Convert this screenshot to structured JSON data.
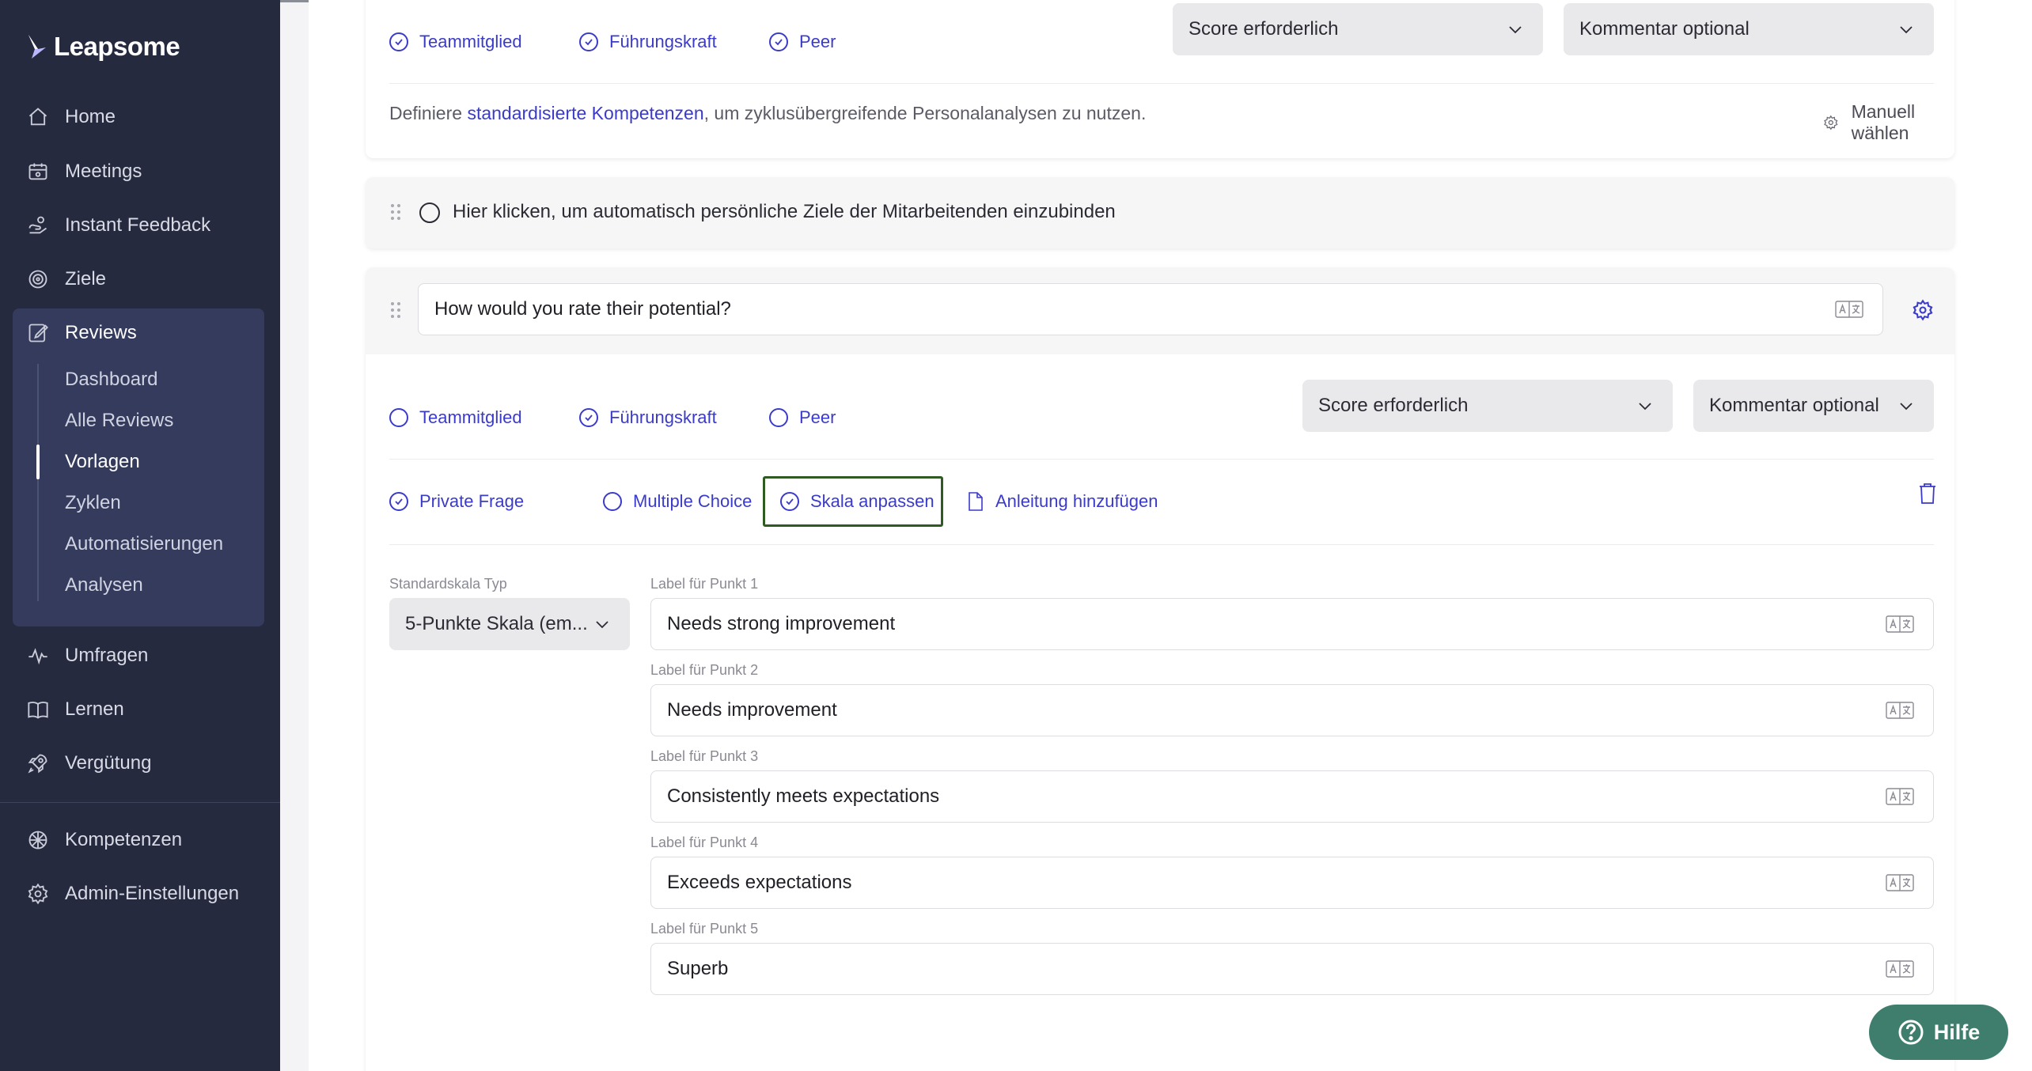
{
  "brand": {
    "name": "Leapsome"
  },
  "sidebar": {
    "items": [
      {
        "label": "Home",
        "icon": "home-icon"
      },
      {
        "label": "Meetings",
        "icon": "meetings-icon"
      },
      {
        "label": "Instant Feedback",
        "icon": "feedback-icon"
      },
      {
        "label": "Ziele",
        "icon": "target-icon"
      },
      {
        "label": "Reviews",
        "icon": "reviews-icon"
      },
      {
        "label": "Umfragen",
        "icon": "pulse-icon"
      },
      {
        "label": "Lernen",
        "icon": "book-icon"
      },
      {
        "label": "Vergütung",
        "icon": "rocket-icon"
      },
      {
        "label": "Kompetenzen",
        "icon": "competencies-icon"
      },
      {
        "label": "Admin-Einstellungen",
        "icon": "gear-icon"
      }
    ],
    "reviews_sub": [
      {
        "label": "Dashboard"
      },
      {
        "label": "Alle Reviews"
      },
      {
        "label": "Vorlagen",
        "active": true
      },
      {
        "label": "Zyklen"
      },
      {
        "label": "Automatisierungen"
      },
      {
        "label": "Analysen"
      }
    ]
  },
  "question1": {
    "roles": [
      {
        "label": "Teammitglied",
        "checked": true
      },
      {
        "label": "Führungskraft",
        "checked": true
      },
      {
        "label": "Peer",
        "checked": true
      }
    ],
    "score_select": "Score erforderlich",
    "comment_select": "Kommentar optional",
    "competency_text_before": "Definiere ",
    "competency_link": "standardisierte Kompetenzen",
    "competency_text_after": ", um zyklusübergreifende Personalanalysen zu nutzen.",
    "manual_select": "Manuell wählen"
  },
  "goals_toggle": {
    "label": "Hier klicken, um automatisch persönliche Ziele der Mitarbeitenden einzubinden"
  },
  "question2": {
    "text": "How would you rate their potential?",
    "roles": [
      {
        "label": "Teammitglied",
        "checked": false
      },
      {
        "label": "Führungskraft",
        "checked": true
      },
      {
        "label": "Peer",
        "checked": false
      }
    ],
    "score_select": "Score erforderlich",
    "comment_select": "Kommentar optional",
    "options": [
      {
        "label": "Private Frage",
        "checked": true
      },
      {
        "label": "Multiple Choice",
        "checked": false
      },
      {
        "label": "Skala anpassen",
        "checked": true
      },
      {
        "label": "Anleitung hinzufügen"
      }
    ],
    "scale_type_label": "Standardskala Typ",
    "scale_type_value": "5-Punkte Skala (em...",
    "scale_points": [
      {
        "label": "Label für Punkt 1",
        "value": "Needs strong improvement"
      },
      {
        "label": "Label für Punkt 2",
        "value": "Needs improvement"
      },
      {
        "label": "Label für Punkt 3",
        "value": "Consistently meets expectations"
      },
      {
        "label": "Label für Punkt 4",
        "value": "Exceeds expectations"
      },
      {
        "label": "Label für Punkt 5",
        "value": "Superb"
      }
    ]
  },
  "help": {
    "label": "Hilfe"
  },
  "colors": {
    "sidebar": "#262a3e",
    "accent": "#3b3bc9",
    "help": "#3f7e6d",
    "highlight": "#2f5a22"
  }
}
